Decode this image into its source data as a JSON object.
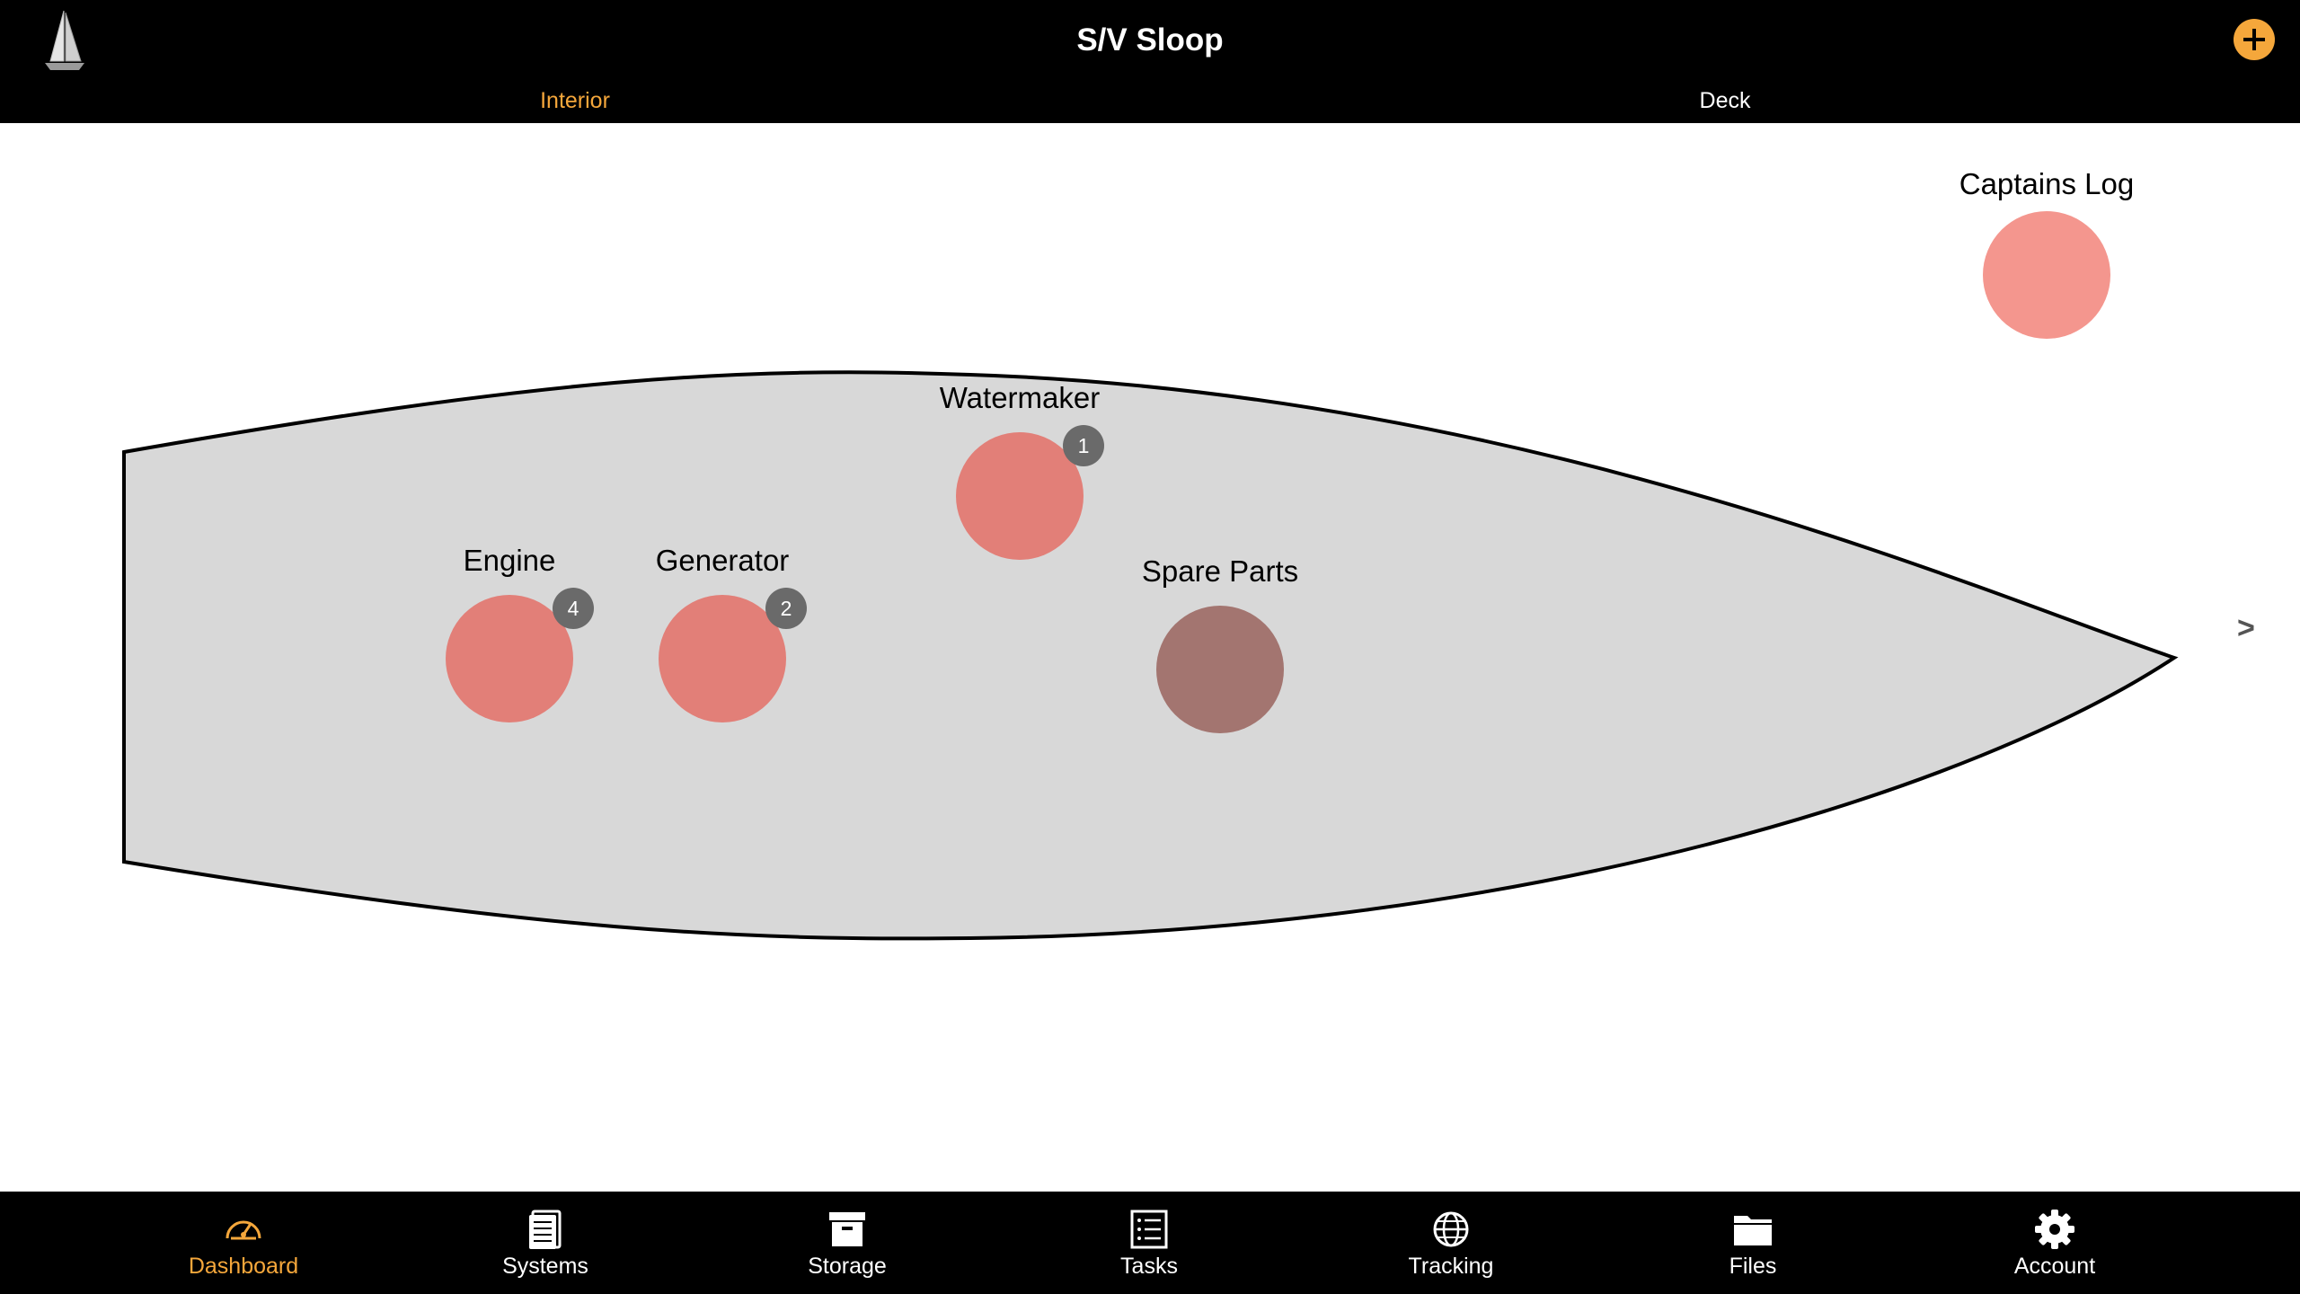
{
  "header": {
    "title": "S/V Sloop",
    "logo_icon": "sailboat-icon",
    "add_icon": "plus-icon",
    "accent_color": "#f5a73b"
  },
  "segments": [
    {
      "label": "Interior",
      "active": true
    },
    {
      "label": "Deck",
      "active": false
    }
  ],
  "hull": {
    "fill": "#d8d8d8",
    "stroke": "#000000"
  },
  "points": {
    "captains_log": {
      "label": "Captains Log",
      "color": "#f4968e",
      "badge": ""
    },
    "watermaker": {
      "label": "Watermaker",
      "color": "#e27f78",
      "badge": "1"
    },
    "engine": {
      "label": "Engine",
      "color": "#e27f78",
      "badge": "4"
    },
    "generator": {
      "label": "Generator",
      "color": "#e27f78",
      "badge": "2"
    },
    "spare_parts": {
      "label": "Spare Parts",
      "color": "#a37570",
      "badge": ""
    }
  },
  "badge_color": "#6a6a6a",
  "next_arrow": ">",
  "tabbar": {
    "active_color": "#f5a73b",
    "inactive_color": "#ffffff",
    "items": [
      {
        "label": "Dashboard",
        "icon": "speedometer-icon",
        "active": true
      },
      {
        "label": "Systems",
        "icon": "document-list-icon",
        "active": false
      },
      {
        "label": "Storage",
        "icon": "archive-box-icon",
        "active": false
      },
      {
        "label": "Tasks",
        "icon": "checklist-icon",
        "active": false
      },
      {
        "label": "Tracking",
        "icon": "globe-icon",
        "active": false
      },
      {
        "label": "Files",
        "icon": "folder-icon",
        "active": false
      },
      {
        "label": "Account",
        "icon": "gear-icon",
        "active": false
      }
    ]
  }
}
